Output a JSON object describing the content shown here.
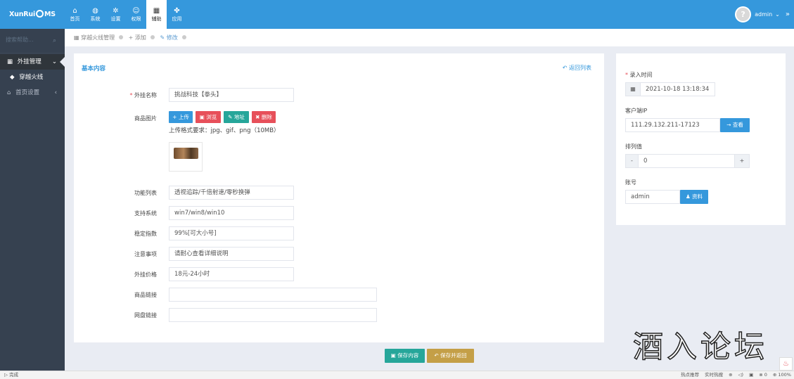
{
  "app": {
    "logo_left": "XunRui",
    "logo_right": "MS"
  },
  "topnav": [
    {
      "icon": "home-icon",
      "glyph": "⌂",
      "label": "首页"
    },
    {
      "icon": "globe-icon",
      "glyph": "◍",
      "label": "系统"
    },
    {
      "icon": "cogs-icon",
      "glyph": "✲",
      "label": "设置"
    },
    {
      "icon": "user-circle-icon",
      "glyph": "☺",
      "label": "权限"
    },
    {
      "icon": "grid-icon",
      "glyph": "▦",
      "label": "辅助"
    },
    {
      "icon": "puzzle-icon",
      "glyph": "✤",
      "label": "应用"
    }
  ],
  "user": {
    "name": "admin",
    "avatar": "?",
    "caret": "⌄",
    "expand": "»"
  },
  "sidebar": {
    "search_placeholder": "搜索帮助...",
    "items": [
      {
        "label": "外挂管理",
        "icon": "grid-icon",
        "glyph": "▦",
        "arrow": "⌄"
      },
      {
        "label": "穿越火线",
        "icon": "diamond-icon",
        "glyph": "◆"
      },
      {
        "label": "首页设置",
        "icon": "bank-icon",
        "glyph": "⌂",
        "arrow": "‹"
      }
    ]
  },
  "breadcrumb": [
    {
      "icon_glyph": "▦",
      "label": "穿越火线管理"
    },
    {
      "icon_glyph": "+",
      "label": "添加"
    },
    {
      "icon_glyph": "✎",
      "label": "修改"
    }
  ],
  "form": {
    "caption": "基本内容",
    "back_label": "返回列表",
    "name_label": "外挂名称",
    "name_value": "挑战科技【拳头】",
    "image_label": "商品图片",
    "upload_buttons": [
      "+ 上传",
      "▣ 浏览",
      "✎ 地址",
      "✖ 删除"
    ],
    "upload_hint": "上传格式要求：jpg、gif、png（10MB）",
    "fields": [
      {
        "label": "功能列表",
        "value": "透视追踪/千倍射速/零秒换弹"
      },
      {
        "label": "支持系统",
        "value": "win7/win8/win10"
      },
      {
        "label": "稳定指数",
        "value": "99%[可大小号]"
      },
      {
        "label": "注意事项",
        "value": "请耐心查看详细说明"
      },
      {
        "label": "外挂价格",
        "value": "18元-24小时"
      },
      {
        "label": "商品链接",
        "value": ""
      },
      {
        "label": "网盘链接",
        "value": ""
      }
    ]
  },
  "sidepanel": {
    "time_label": "录入时间",
    "time_value": "2021-10-18 13:18:34",
    "ip_label": "客户端IP",
    "ip_value": "111.29.132.211-17123",
    "ip_button": "→ 查看",
    "order_label": "排列值",
    "order_minus": "-",
    "order_value": "0",
    "order_plus": "+",
    "account_label": "账号",
    "account_value": "admin",
    "account_button": "♟ 资料"
  },
  "footer": {
    "save": "▣ 保存内容",
    "save_return": "↶ 保存并返回"
  },
  "watermark": "酒入论坛",
  "statusbar": {
    "left": "完成",
    "right": [
      "热点推荐",
      "实时热搜",
      "⊕",
      "◁)",
      "▣",
      "⊗ 0",
      "⊕ 100%"
    ]
  }
}
